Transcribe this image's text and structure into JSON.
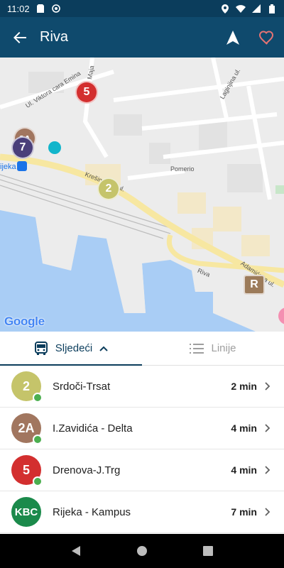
{
  "status_bar": {
    "time": "11:02",
    "icons": [
      "sd-card-icon",
      "data-saver-icon",
      "location-icon",
      "wifi-icon",
      "signal-icon",
      "battery-icon"
    ]
  },
  "app_bar": {
    "title": "Riva",
    "icons": [
      "back-arrow-icon",
      "navigation-icon",
      "heart-outline-icon"
    ],
    "heart_color": "#e57373"
  },
  "map": {
    "street_labels": [
      "Ul. Viktora cara Emina",
      "Maja",
      "Laginjina ul.",
      "Krešimirova ul.",
      "Pomerio",
      "Riva",
      "Adamićeva ul.",
      "ijeka"
    ],
    "markers": [
      {
        "label": "5",
        "color": "#d32f2f"
      },
      {
        "label": "2A",
        "color": "#a1765f"
      },
      {
        "label": "7",
        "color": "#4a3f7a"
      },
      {
        "label": "2",
        "color": "#c5c46a"
      },
      {
        "label": "R",
        "color": "#9c7b5a"
      }
    ],
    "attribution": "Google",
    "water_color": "#a9cdf5",
    "land_color": "#ececec",
    "road_color": "#f7e7a1"
  },
  "tabs": {
    "next": {
      "label": "Sljedeći",
      "icon": "bus-icon"
    },
    "lines": {
      "label": "Linije",
      "icon": "list-icon"
    }
  },
  "departures": [
    {
      "badge": "2",
      "color": "#c5c46a",
      "name": "Srdoči-Trsat",
      "time": "2 min",
      "live": true
    },
    {
      "badge": "2A",
      "color": "#a1765f",
      "name": "I.Zavidića - Delta",
      "time": "4 min",
      "live": true
    },
    {
      "badge": "5",
      "color": "#d32f2f",
      "name": "Drenova-J.Trg",
      "time": "4 min",
      "live": true
    },
    {
      "badge": "KBC",
      "color": "#1b8a4b",
      "name": "Rijeka - Kampus",
      "time": "7 min",
      "live": false
    }
  ],
  "nav_bar": {
    "icons": [
      "nav-back-icon",
      "nav-home-icon",
      "nav-recents-icon"
    ]
  }
}
